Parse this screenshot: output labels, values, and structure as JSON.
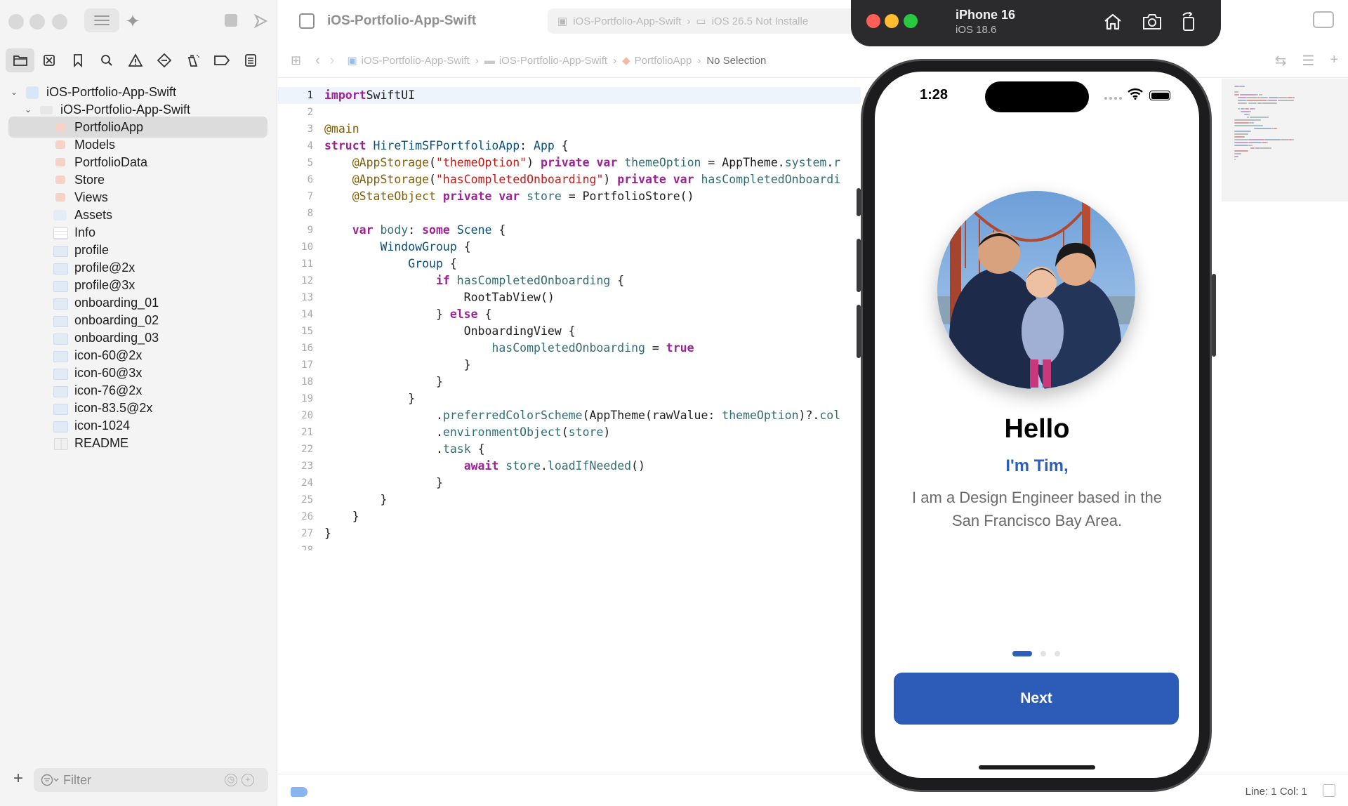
{
  "sidebar": {
    "tree": [
      {
        "label": "iOS-Portfolio-App-Swift",
        "kind": "project",
        "expanded": true
      },
      {
        "label": "iOS-Portfolio-App-Swift",
        "kind": "folder",
        "expanded": true
      },
      {
        "label": "PortfolioApp",
        "kind": "swift",
        "selected": true
      },
      {
        "label": "Models",
        "kind": "swift"
      },
      {
        "label": "PortfolioData",
        "kind": "swift"
      },
      {
        "label": "Store",
        "kind": "swift"
      },
      {
        "label": "Views",
        "kind": "swift"
      },
      {
        "label": "Assets",
        "kind": "assets"
      },
      {
        "label": "Info",
        "kind": "table"
      },
      {
        "label": "profile",
        "kind": "image"
      },
      {
        "label": "profile@2x",
        "kind": "image"
      },
      {
        "label": "profile@3x",
        "kind": "image"
      },
      {
        "label": "onboarding_01",
        "kind": "image"
      },
      {
        "label": "onboarding_02",
        "kind": "image"
      },
      {
        "label": "onboarding_03",
        "kind": "image"
      },
      {
        "label": "icon-60@2x",
        "kind": "image"
      },
      {
        "label": "icon-60@3x",
        "kind": "image"
      },
      {
        "label": "icon-76@2x",
        "kind": "image"
      },
      {
        "label": "icon-83.5@2x",
        "kind": "image"
      },
      {
        "label": "icon-1024",
        "kind": "image"
      },
      {
        "label": "README",
        "kind": "book"
      }
    ],
    "filter_placeholder": "Filter"
  },
  "editor": {
    "project_title": "iOS-Portfolio-App-Swift",
    "scheme": {
      "target": "iOS-Portfolio-App-Swift",
      "destination": "iOS 26.5 Not Installe"
    },
    "jump_bar": [
      "iOS-Portfolio-App-Swift",
      "iOS-Portfolio-App-Swift",
      "PortfolioApp",
      "No Selection"
    ],
    "current_line": 1,
    "code_lines": [
      [
        [
          "kw",
          "import"
        ],
        [
          "",
          "SwiftUI"
        ]
      ],
      [],
      [
        [
          "attr",
          "@main"
        ]
      ],
      [
        [
          "kw",
          "struct"
        ],
        [
          "",
          " "
        ],
        [
          "ty",
          "HireTimSFPortfolioApp"
        ],
        [
          "",
          ": "
        ],
        [
          "ty",
          "App"
        ],
        [
          "",
          " {"
        ]
      ],
      [
        [
          "",
          "    "
        ],
        [
          "attr",
          "@AppStorage"
        ],
        [
          "",
          "("
        ],
        [
          "str",
          "\"themeOption\""
        ],
        [
          "",
          ") "
        ],
        [
          "kw",
          "private var"
        ],
        [
          "",
          " "
        ],
        [
          "id",
          "themeOption"
        ],
        [
          "",
          " = AppTheme."
        ],
        [
          "id",
          "system"
        ],
        [
          "",
          "."
        ],
        [
          "id",
          "r"
        ]
      ],
      [
        [
          "",
          "    "
        ],
        [
          "attr",
          "@AppStorage"
        ],
        [
          "",
          "("
        ],
        [
          "str",
          "\"hasCompletedOnboarding\""
        ],
        [
          "",
          ") "
        ],
        [
          "kw",
          "private var"
        ],
        [
          "",
          " "
        ],
        [
          "id",
          "hasCompletedOnboardi"
        ]
      ],
      [
        [
          "",
          "    "
        ],
        [
          "attr",
          "@StateObject"
        ],
        [
          "",
          " "
        ],
        [
          "kw",
          "private var"
        ],
        [
          "",
          " "
        ],
        [
          "id",
          "store"
        ],
        [
          "",
          " = PortfolioStore()"
        ]
      ],
      [],
      [
        [
          "",
          "    "
        ],
        [
          "kw",
          "var"
        ],
        [
          "",
          " "
        ],
        [
          "id",
          "body"
        ],
        [
          "",
          ": "
        ],
        [
          "kw",
          "some"
        ],
        [
          "",
          " "
        ],
        [
          "ty",
          "Scene"
        ],
        [
          "",
          " {"
        ]
      ],
      [
        [
          "",
          "        "
        ],
        [
          "ty",
          "WindowGroup"
        ],
        [
          "",
          " {"
        ]
      ],
      [
        [
          "",
          "            "
        ],
        [
          "ty",
          "Group"
        ],
        [
          "",
          " {"
        ]
      ],
      [
        [
          "",
          "                "
        ],
        [
          "kw",
          "if"
        ],
        [
          "",
          " "
        ],
        [
          "id",
          "hasCompletedOnboarding"
        ],
        [
          "",
          " {"
        ]
      ],
      [
        [
          "",
          "                    RootTabView()"
        ]
      ],
      [
        [
          "",
          "                } "
        ],
        [
          "kw",
          "else"
        ],
        [
          "",
          " {"
        ]
      ],
      [
        [
          "",
          "                    OnboardingView {"
        ]
      ],
      [
        [
          "",
          "                        "
        ],
        [
          "id",
          "hasCompletedOnboarding"
        ],
        [
          "",
          " = "
        ],
        [
          "kw",
          "true"
        ]
      ],
      [
        [
          "",
          "                    }"
        ]
      ],
      [
        [
          "",
          "                }"
        ]
      ],
      [
        [
          "",
          "            }"
        ]
      ],
      [
        [
          "",
          "                ."
        ],
        [
          "id",
          "preferredColorScheme"
        ],
        [
          "",
          "(AppTheme(rawValue: "
        ],
        [
          "id",
          "themeOption"
        ],
        [
          "",
          ")?."
        ],
        [
          "id",
          "col"
        ]
      ],
      [
        [
          "",
          "                ."
        ],
        [
          "id",
          "environmentObject"
        ],
        [
          "",
          "("
        ],
        [
          "id",
          "store"
        ],
        [
          "",
          ")"
        ]
      ],
      [
        [
          "",
          "                ."
        ],
        [
          "id",
          "task"
        ],
        [
          "",
          " {"
        ]
      ],
      [
        [
          "",
          "                    "
        ],
        [
          "kw",
          "await"
        ],
        [
          "",
          " "
        ],
        [
          "id",
          "store"
        ],
        [
          "",
          "."
        ],
        [
          "id",
          "loadIfNeeded"
        ],
        [
          "",
          "()"
        ]
      ],
      [
        [
          "",
          "                }"
        ]
      ],
      [
        [
          "",
          "        }"
        ]
      ],
      [
        [
          "",
          "    }"
        ]
      ],
      [
        [
          "",
          "}"
        ]
      ],
      []
    ],
    "status": {
      "line_col": "Line: 1  Col: 1"
    }
  },
  "simulator": {
    "device": "iPhone 16",
    "os": "iOS 18.6",
    "status_time": "1:28",
    "onboarding": {
      "title": "Hello",
      "subtitle": "I'm Tim,",
      "bio": "I am a Design Engineer based in the San Francisco Bay Area.",
      "page_count": 3,
      "current_page": 1,
      "next_label": "Next"
    },
    "colors": {
      "accent": "#2c5cb7",
      "subtitle": "#2f5fb8"
    }
  }
}
